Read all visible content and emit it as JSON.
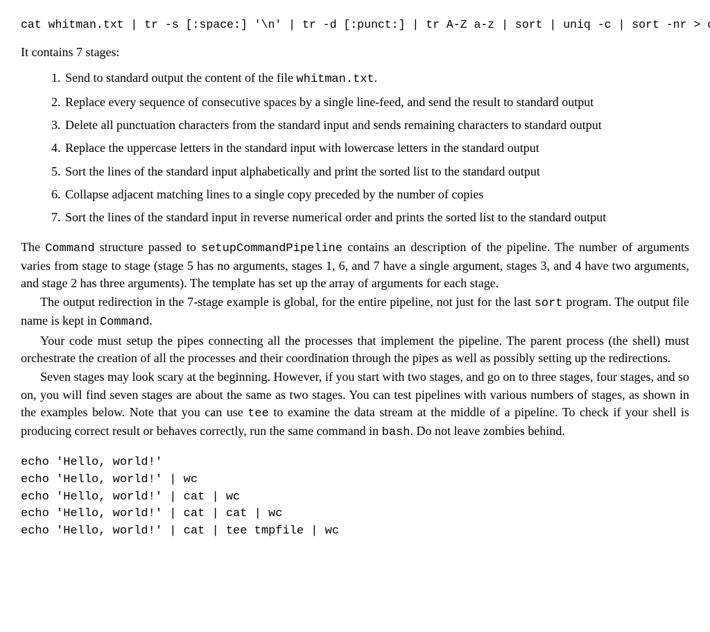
{
  "cmd": "cat whitman.txt | tr -s [:space:] '\\n' | tr -d [:punct:] | tr A-Z a-z | sort | uniq -c | sort -nr > counts.txt",
  "intro": "It contains 7 stages:",
  "stages": [
    {
      "pre": "Send to standard output the content of the file ",
      "code": "whitman.txt",
      "post": "."
    },
    {
      "text": "Replace every sequence of consecutive spaces by a single line-feed, and send the result to standard output"
    },
    {
      "text": "Delete all punctuation characters from the standard input and sends remaining characters to standard output"
    },
    {
      "text": "Replace the uppercase letters in the standard input with lowercase letters in the standard output"
    },
    {
      "text": "Sort the lines of the standard input alphabetically and print the sorted list to the standard output"
    },
    {
      "text": "Collapse adjacent matching lines to a single copy preceded by the number of copies"
    },
    {
      "text": "Sort the lines of the standard input in reverse numerical order and prints the sorted list to the standard output"
    }
  ],
  "p1": {
    "a": "The ",
    "c1": "Command",
    "b": " structure passed to ",
    "c2": "setupCommandPipeline",
    "c": " contains an description of the pipeline. The number of arguments varies from stage to stage (stage 5 has no arguments, stages 1, 6, and 7 have a single argument, stages 3, and 4 have two arguments, and stage 2 has three arguments). The template has set up the array of arguments for each stage."
  },
  "p2": {
    "a": "The output redirection in the 7-stage example is global, for the entire pipeline, not just for the last ",
    "c1": "sort",
    "b": " program. The output file name is kept in ",
    "c2": "Command",
    "c": "."
  },
  "p3": "Your code must setup the pipes connecting all the processes that implement the pipeline. The parent process (the shell) must orchestrate the creation of all the processes and their coordination through the pipes as well as possibly setting up the redirections.",
  "p4": {
    "a": "Seven stages may look scary at the beginning. However, if you start with two stages, and go on to three stages, four stages, and so on, you will find seven stages are about the same as two stages. You can test pipelines with various numbers of stages, as shown in the examples below. Note that you can use ",
    "c1": "tee",
    "b": " to examine the data stream at the middle of a pipeline. To check if your shell is producing correct result or behaves correctly, run the same command in ",
    "c2": "bash",
    "c": ". Do not leave zombies behind."
  },
  "examples": [
    "echo 'Hello, world!'",
    "echo 'Hello, world!' | wc",
    "echo 'Hello, world!' | cat | wc",
    "echo 'Hello, world!' | cat | cat | wc",
    "echo 'Hello, world!' | cat | tee tmpfile | wc"
  ]
}
